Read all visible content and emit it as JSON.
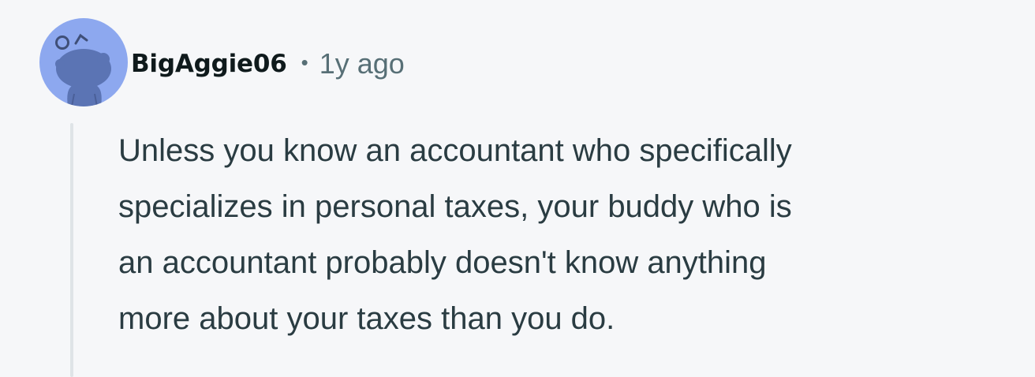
{
  "comment": {
    "author": "BigAggie06",
    "separator": "•",
    "timestamp": "1y ago",
    "body_lines": [
      "Unless you know an accountant who specifically",
      "specializes in personal taxes, your buddy who is",
      "an accountant probably doesn't know anything",
      "more about your taxes than you do."
    ],
    "avatar_icon": "snoo-avatar-icon"
  },
  "colors": {
    "background": "#f6f7f9",
    "avatar_bg": "#8da8ef",
    "avatar_figure": "#5b74b4",
    "username": "#0f1a1c",
    "meta": "#576f76",
    "body": "#2a3c42",
    "thread_line": "#dfe4e7"
  }
}
